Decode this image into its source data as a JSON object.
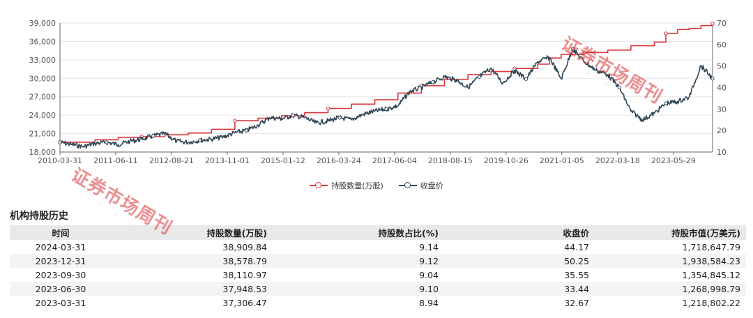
{
  "chart_data": {
    "type": "line",
    "x_tick_labels": [
      "2010-03-31",
      "2011-06-11",
      "2012-08-21",
      "2013-11-01",
      "2015-01-12",
      "2016-03-24",
      "2017-06-04",
      "2018-08-15",
      "2019-10-26",
      "2021-01-05",
      "2022-03-18",
      "2023-05-29"
    ],
    "x_range": [
      "2010-03-31",
      "2024-03-31"
    ],
    "y_left": {
      "ticks": [
        "18,000",
        "21,000",
        "24,000",
        "27,000",
        "30,000",
        "33,000",
        "36,000",
        "39,000"
      ],
      "min": 18000,
      "max": 39000
    },
    "y_right": {
      "ticks": [
        "10",
        "20",
        "30",
        "40",
        "50",
        "60",
        "70"
      ],
      "min": 10,
      "max": 70
    },
    "grid": "horizontal",
    "legend_position": "bottom-center",
    "series": [
      {
        "name": "持股数量(万股)",
        "axis": "left",
        "color": "#d9353a",
        "step": true,
        "points": [
          [
            "2010-03-31",
            19600
          ],
          [
            "2010-09-30",
            19600
          ],
          [
            "2010-12-31",
            20000
          ],
          [
            "2011-06-30",
            20400
          ],
          [
            "2011-12-31",
            20500
          ],
          [
            "2012-06-30",
            20800
          ],
          [
            "2012-12-31",
            21100
          ],
          [
            "2013-06-30",
            21700
          ],
          [
            "2013-12-31",
            23100
          ],
          [
            "2014-06-30",
            23500
          ],
          [
            "2014-12-31",
            23900
          ],
          [
            "2015-06-30",
            24400
          ],
          [
            "2015-12-31",
            25100
          ],
          [
            "2016-06-30",
            25800
          ],
          [
            "2016-12-31",
            26500
          ],
          [
            "2017-06-30",
            27600
          ],
          [
            "2017-12-31",
            28800
          ],
          [
            "2018-06-30",
            29800
          ],
          [
            "2018-12-31",
            30600
          ],
          [
            "2019-06-30",
            31100
          ],
          [
            "2019-12-31",
            31600
          ],
          [
            "2020-06-30",
            32300
          ],
          [
            "2020-09-30",
            33300
          ],
          [
            "2020-12-31",
            33900
          ],
          [
            "2021-06-30",
            34200
          ],
          [
            "2021-12-31",
            34600
          ],
          [
            "2022-06-30",
            35300
          ],
          [
            "2022-12-31",
            35900
          ],
          [
            "2023-03-31",
            37306.47
          ],
          [
            "2023-06-30",
            37948.53
          ],
          [
            "2023-09-30",
            38110.97
          ],
          [
            "2023-12-31",
            38578.79
          ],
          [
            "2024-03-31",
            38909.84
          ]
        ]
      },
      {
        "name": "收盘价",
        "axis": "right",
        "color": "#2e4453",
        "step": false,
        "points": [
          [
            "2010-03-31",
            14.5
          ],
          [
            "2010-06-30",
            13.5
          ],
          [
            "2010-09-30",
            12.5
          ],
          [
            "2010-12-31",
            14
          ],
          [
            "2011-03-31",
            14.5
          ],
          [
            "2011-06-30",
            13.5
          ],
          [
            "2011-09-30",
            15
          ],
          [
            "2011-12-31",
            16
          ],
          [
            "2012-03-31",
            17.5
          ],
          [
            "2012-06-30",
            18.5
          ],
          [
            "2012-09-30",
            15
          ],
          [
            "2012-12-31",
            14.5
          ],
          [
            "2013-03-31",
            15.5
          ],
          [
            "2013-06-30",
            16
          ],
          [
            "2013-09-30",
            17
          ],
          [
            "2013-12-31",
            19
          ],
          [
            "2014-03-31",
            20
          ],
          [
            "2014-06-30",
            22.5
          ],
          [
            "2014-09-30",
            26
          ],
          [
            "2014-12-31",
            25.5
          ],
          [
            "2015-03-31",
            27
          ],
          [
            "2015-06-30",
            26
          ],
          [
            "2015-09-30",
            23.5
          ],
          [
            "2015-12-31",
            24.5
          ],
          [
            "2016-03-31",
            26
          ],
          [
            "2016-06-30",
            25
          ],
          [
            "2016-09-30",
            27.5
          ],
          [
            "2016-12-31",
            29
          ],
          [
            "2017-03-31",
            30
          ],
          [
            "2017-06-30",
            31.5
          ],
          [
            "2017-09-30",
            38
          ],
          [
            "2017-12-31",
            40
          ],
          [
            "2018-03-31",
            42.5
          ],
          [
            "2018-06-30",
            45
          ],
          [
            "2018-09-30",
            43.5
          ],
          [
            "2018-12-31",
            40
          ],
          [
            "2019-03-31",
            45
          ],
          [
            "2019-06-30",
            49
          ],
          [
            "2019-09-30",
            42
          ],
          [
            "2019-12-31",
            48
          ],
          [
            "2020-03-31",
            44
          ],
          [
            "2020-06-30",
            52
          ],
          [
            "2020-09-30",
            54
          ],
          [
            "2020-12-31",
            44
          ],
          [
            "2021-03-31",
            58
          ],
          [
            "2021-06-30",
            52
          ],
          [
            "2021-09-30",
            48
          ],
          [
            "2021-12-31",
            46
          ],
          [
            "2022-03-31",
            40
          ],
          [
            "2022-06-30",
            29
          ],
          [
            "2022-09-30",
            25
          ],
          [
            "2022-12-31",
            28
          ],
          [
            "2023-03-31",
            32.67
          ],
          [
            "2023-06-30",
            33.44
          ],
          [
            "2023-09-30",
            35.55
          ],
          [
            "2023-12-31",
            50.25
          ],
          [
            "2024-03-31",
            44.17
          ]
        ]
      }
    ]
  },
  "legend": {
    "items": [
      {
        "label": "持股数量(万股)",
        "color": "#d9353a"
      },
      {
        "label": "收盘价",
        "color": "#2e4453"
      }
    ]
  },
  "table": {
    "title": "机构持股历史",
    "columns": [
      "时间",
      "持股数量(万股)",
      "持股数占比(%)",
      "收盘价",
      "持股市值(万美元)"
    ],
    "rows": [
      [
        "2024-03-31",
        "38,909.84",
        "9.14",
        "44.17",
        "1,718,647.79"
      ],
      [
        "2023-12-31",
        "38,578.79",
        "9.12",
        "50.25",
        "1,938,584.23"
      ],
      [
        "2023-09-30",
        "38,110.97",
        "9.04",
        "35.55",
        "1,354,845.12"
      ],
      [
        "2023-06-30",
        "37,948.53",
        "9.10",
        "33.44",
        "1,268,998.79"
      ],
      [
        "2023-03-31",
        "37,306.47",
        "8.94",
        "32.67",
        "1,218,802.22"
      ]
    ]
  },
  "watermarks": [
    {
      "text": "证券市场周刊",
      "color": "#d9353a"
    },
    {
      "text": "证券市场周刊",
      "color": "#d9353a"
    }
  ]
}
